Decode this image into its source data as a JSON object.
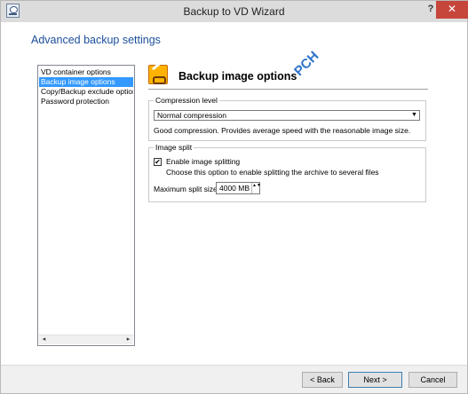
{
  "window": {
    "title": "Backup to VD Wizard",
    "help_label": "?",
    "close_label": "✕"
  },
  "header": {
    "title": "Advanced backup settings"
  },
  "nav": {
    "items": [
      {
        "label": "VD container options",
        "selected": false
      },
      {
        "label": "Backup image options",
        "selected": true
      },
      {
        "label": "Copy/Backup exclude options",
        "selected": false
      },
      {
        "label": "Password protection",
        "selected": false
      }
    ],
    "scroll_left": "◂",
    "scroll_right": "▸"
  },
  "panel": {
    "title": "Backup image options",
    "watermark": "PCH"
  },
  "compression": {
    "group_label": "Compression level",
    "selected_value": "Normal compression",
    "dropdown_arrow": "▼",
    "description": "Good compression. Provides average speed with the reasonable image size."
  },
  "split": {
    "group_label": "Image split",
    "checkbox_checked": true,
    "check_mark": "✔",
    "enable_label": "Enable image splitting",
    "description": "Choose this option to enable splitting the archive to several files",
    "max_size_label": "Maximum split size:",
    "max_size_value": "4000 MB",
    "spin_arrows": "▲▼"
  },
  "footer": {
    "back_label": "< Back",
    "next_label": "Next >",
    "cancel_label": "Cancel"
  }
}
